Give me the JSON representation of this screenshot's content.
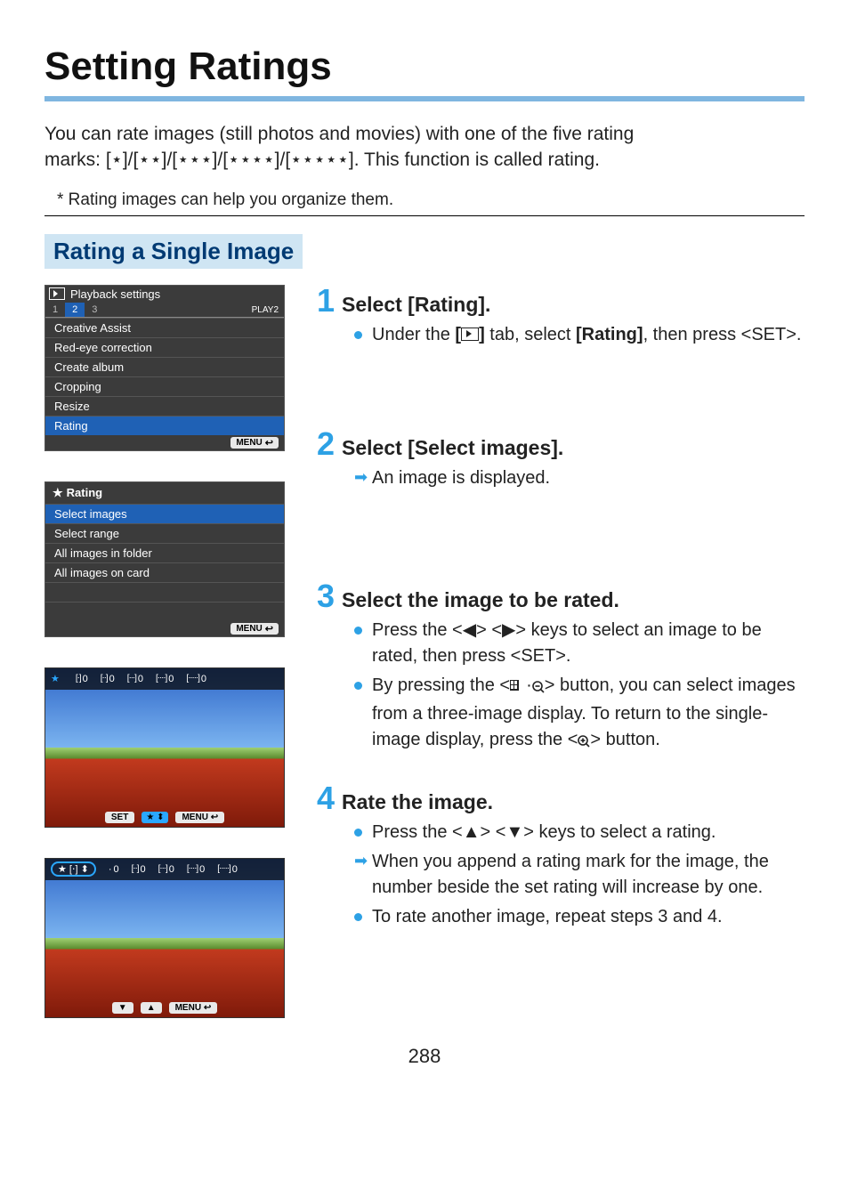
{
  "title": "Setting Ratings",
  "intro_line1": "You can rate images (still photos and movies) with one of the five rating",
  "intro_line2_a": "marks: ",
  "intro_line2_b": ". This function is called rating.",
  "rating_marks": "[⋆]/[⋆⋆]/[⋆⋆⋆]/[⋆⋆⋆⋆]/[⋆⋆⋆⋆⋆]",
  "footnote": "*  Rating images can help you organize them.",
  "section_heading": "Rating a Single Image",
  "screenshot1": {
    "header": "Playback settings",
    "tabs": [
      "1",
      "2",
      "3"
    ],
    "active_tab": "2",
    "tab_label": "PLAY2",
    "menu_items": [
      "Creative Assist",
      "Red-eye correction",
      "Create album",
      "Cropping",
      "Resize",
      "Rating"
    ],
    "selected_item": "Rating",
    "footer_button": "MENU"
  },
  "screenshot2": {
    "title_star": "★",
    "title": "Rating",
    "items": [
      "Select images",
      "Select range",
      "All images in folder",
      "All images on card"
    ],
    "selected_item": "Select images",
    "footer_button": "MENU"
  },
  "screenshot3": {
    "star": "★",
    "counts": [
      "0",
      "0",
      "0",
      "0",
      "0"
    ],
    "set_label": "SET",
    "menu_label": "MENU"
  },
  "screenshot4": {
    "star": "★",
    "counts": [
      "0",
      "0",
      "0",
      "0",
      "0"
    ],
    "menu_label": "MENU"
  },
  "step1": {
    "num": "1",
    "title": "Select [Rating].",
    "bullet1_a": "Under the ",
    "bullet1_b": " tab, select ",
    "bullet1_c": ", then press <",
    "bullet1_d": ">.",
    "rating_bold": "[Rating]",
    "set_label": "SET"
  },
  "step2": {
    "num": "2",
    "title": "Select [Select images].",
    "bullet1": "An image is displayed."
  },
  "step3": {
    "num": "3",
    "title": "Select the image to be rated.",
    "b1_a": "Press the <",
    "b1_b": "> <",
    "b1_c": "> keys to select an image to be rated, then press <",
    "b1_d": ">.",
    "set_label": "SET",
    "b2_a": "By pressing the <",
    "b2_b": "> button, you can select images from a three-image display. To return to the single-image display, press the <",
    "b2_c": "> button."
  },
  "step4": {
    "num": "4",
    "title": "Rate the image.",
    "b1_a": "Press the <",
    "b1_b": "> <",
    "b1_c": "> keys to select a rating.",
    "b2": "When you append a rating mark for the image, the number beside the set rating will increase by one.",
    "b3": "To rate another image, repeat steps 3 and 4."
  },
  "page_number": "288",
  "glyphs": {
    "left": "◀",
    "right": "▶",
    "up": "▲",
    "down": "▼",
    "back": "↩",
    "magplus": "⊕",
    "magminus": "⊖"
  }
}
